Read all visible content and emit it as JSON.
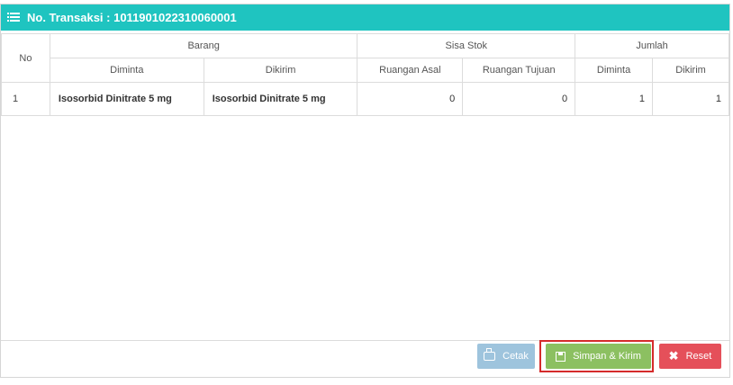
{
  "header": {
    "title": "No. Transaksi : 1011901022310060001",
    "icon": "list-icon"
  },
  "table": {
    "headers": {
      "no": "No",
      "barang": "Barang",
      "sisa_stok": "Sisa Stok",
      "jumlah": "Jumlah",
      "barang_diminta": "Diminta",
      "barang_dikirim": "Dikirim",
      "ruangan_asal": "Ruangan Asal",
      "ruangan_tujuan": "Ruangan Tujuan",
      "jumlah_diminta": "Diminta",
      "jumlah_dikirim": "Dikirim"
    },
    "rows": [
      {
        "no": "1",
        "barang_diminta": "Isosorbid Dinitrate 5 mg",
        "barang_dikirim": "Isosorbid Dinitrate 5 mg",
        "ruangan_asal": "0",
        "ruangan_tujuan": "0",
        "jumlah_diminta": "1",
        "jumlah_dikirim": "1"
      }
    ]
  },
  "buttons": {
    "cetak": "Cetak",
    "simpan_kirim": "Simpan & Kirim",
    "reset": "Reset"
  },
  "colors": {
    "header": "#1fc4c0",
    "cetak": "#9ec4dd",
    "simpan": "#8cc061",
    "reset": "#e5505a",
    "highlight": "#d52b2b"
  }
}
